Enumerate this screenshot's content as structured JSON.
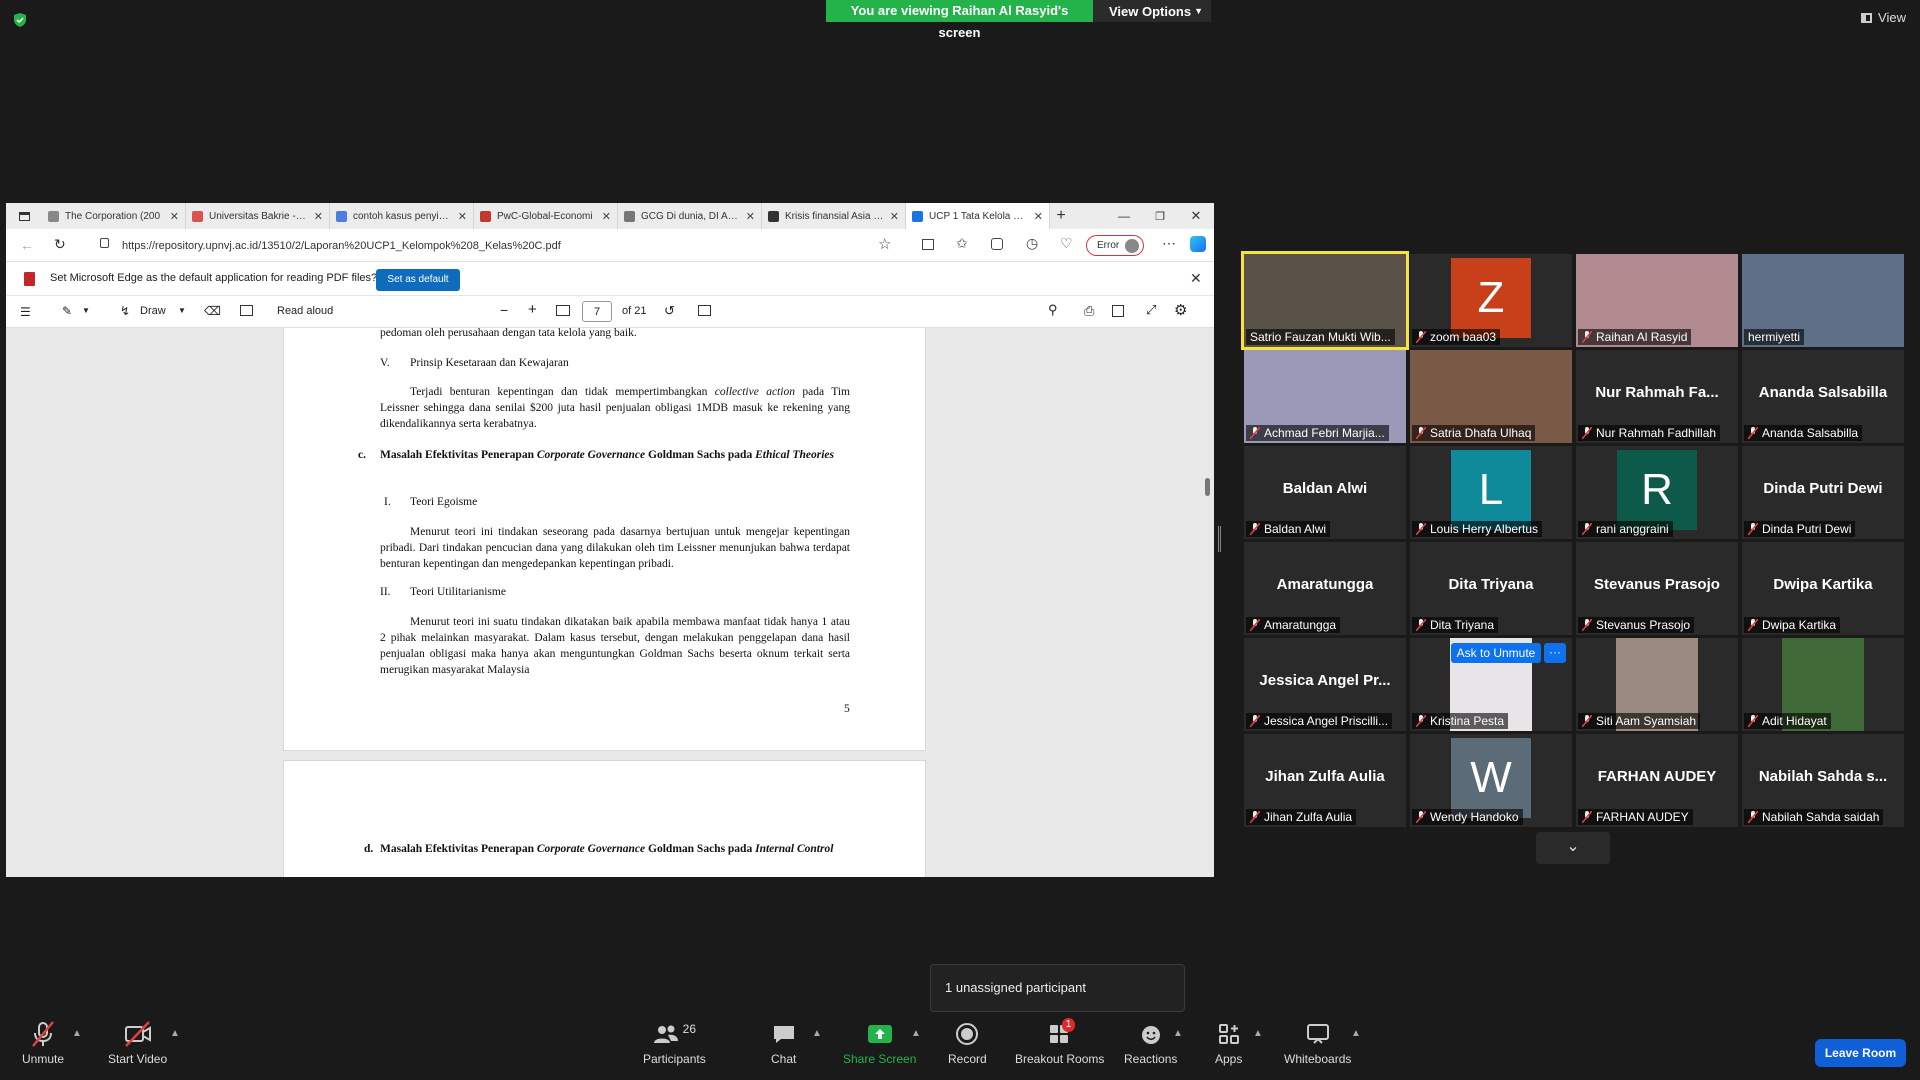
{
  "banner": {
    "message": "You are viewing Raihan Al Rasyid's screen",
    "view_options": "View Options",
    "view_label": "View"
  },
  "browser": {
    "tabs": [
      {
        "title": "The Corporation (200",
        "color": "#888888"
      },
      {
        "title": "Universitas Bakrie - SI",
        "color": "#d9534f"
      },
      {
        "title": "contoh kasus penyimp",
        "color": "#4a7fe0"
      },
      {
        "title": "PwC-Global-Economi",
        "color": "#c0392b"
      },
      {
        "title": "GCG Di dunia, DI Asia",
        "color": "#777777"
      },
      {
        "title": "Krisis finansial Asia 19",
        "color": "#333333"
      },
      {
        "title": "UCP 1 Tata Kelola dan",
        "color": "#1a73e8"
      }
    ],
    "url": "https://repository.upnvj.ac.id/13510/2/Laporan%20UCP1_Kelompok%208_Kelas%20C.pdf",
    "error_label": "Error",
    "infobar_text": "Set Microsoft Edge as the default application for reading PDF files?",
    "set_default": "Set as default",
    "draw": "Draw",
    "read_aloud": "Read aloud",
    "page_number": "7",
    "page_total": "of 21"
  },
  "document": {
    "line_top": "pedoman oleh perusahaan dengan tata kelola yang baik.",
    "v_num": "V.",
    "v_title": "Prinsip Kesetaraan dan Kewajaran",
    "para1_a": "Terjadi benturan kepentingan dan tidak mempertimbangkan ",
    "para1_em": "collective action",
    "para1_b": " pada Tim Leissner sehingga dana senilai $200 juta hasil penjualan obligasi  1MDB masuk ke rekening yang dikendalikannya serta kerabatnya.",
    "c_num": "c.",
    "c_title_a": "Masalah Efektivitas Penerapan ",
    "c_title_em": "Corporate Governance",
    "c_title_b": " Goldman Sachs pada ",
    "c_title_em2": "Ethical Theories",
    "i_num": "I.",
    "i_title": "Teori Egoisme",
    "para2": "Menurut teori ini tindakan seseorang pada dasarnya bertujuan untuk mengejar kepentingan pribadi. Dari tindakan pencucian dana yang dilakukan oleh tim Leissner menunjukan bahwa terdapat benturan kepentingan dan mengedepankan kepentingan pribadi.",
    "ii_num": "II.",
    "ii_title": "Teori Utilitarianisme",
    "para3": "Menurut teori ini suatu tindakan dikatakan baik apabila membawa manfaat tidak hanya 1 atau 2 pihak melainkan masyarakat. Dalam kasus tersebut, dengan melakukan penggelapan dana hasil penjualan obligasi maka hanya akan menguntungkan Goldman Sachs beserta oknum terkait serta merugikan masyarakat Malaysia",
    "page_num": "5",
    "d_num": "d.",
    "d_title_a": "Masalah Efektivitas Penerapan ",
    "d_title_em": "Corporate Governance",
    "d_title_b": " Goldman Sachs pada ",
    "d_title_em2": "Internal Control"
  },
  "gallery": [
    {
      "label": "Satrio Fauzan Mukti Wib...",
      "video": true,
      "bg": "#5a5248",
      "active": true,
      "muted": false
    },
    {
      "label": "zoom baa03",
      "initial": "Z",
      "color": "#c8401a",
      "muted": true
    },
    {
      "label": "Raihan Al Rasyid",
      "video": true,
      "bg": "#b08a8e",
      "muted": true
    },
    {
      "label": "hermiyetti",
      "video": true,
      "bg": "#5e7088",
      "muted": false
    },
    {
      "label": "Achmad Febri Marjia...",
      "video": true,
      "bg": "#9a9ab8",
      "muted": true
    },
    {
      "label": "Satria Dhafa Ulhaq",
      "video": true,
      "bg": "#7a5a46",
      "muted": true
    },
    {
      "label": "Nur Rahmah Fadhillah",
      "name": "Nur Rahmah Fa...",
      "muted": true
    },
    {
      "label": "Ananda Salsabilla",
      "name": "Ananda Salsabilla",
      "muted": true
    },
    {
      "label": "Baldan Alwi",
      "name": "Baldan Alwi",
      "muted": true
    },
    {
      "label": "Louis Herry Albertus",
      "initial": "L",
      "color": "#0e8a9b",
      "muted": true
    },
    {
      "label": "rani anggraini",
      "initial": "R",
      "color": "#0e5a4a",
      "muted": true
    },
    {
      "label": "Dinda Putri Dewi",
      "name": "Dinda Putri Dewi",
      "muted": true
    },
    {
      "label": "Amaratungga",
      "name": "Amaratungga",
      "muted": true
    },
    {
      "label": "Dita Triyana",
      "name": "Dita Triyana",
      "muted": true
    },
    {
      "label": "Stevanus Prasojo",
      "name": "Stevanus Prasojo",
      "muted": true
    },
    {
      "label": "Dwipa Kartika",
      "name": "Dwipa Kartika",
      "muted": true
    },
    {
      "label": "Jessica Angel Priscilli...",
      "name": "Jessica Angel Pr...",
      "muted": true
    },
    {
      "label": "Kristina Pesta",
      "video": true,
      "bg": "#e8e4e8",
      "muted": true
    },
    {
      "label": "Siti Aam Syamsiah",
      "video": true,
      "bg": "#9a8a80",
      "muted": true
    },
    {
      "label": "Adit Hidayat",
      "video": true,
      "bg": "#3f6a38",
      "muted": true
    },
    {
      "label": "Jihan Zulfa Aulia",
      "name": "Jihan Zulfa Aulia",
      "muted": true
    },
    {
      "label": "Wendy Handoko",
      "initial": "W",
      "color": "#5c6b78",
      "muted": true
    },
    {
      "label": "FARHAN AUDEY",
      "name": "FARHAN AUDEY",
      "muted": true
    },
    {
      "label": "Nabilah Sahda saidah",
      "name": "Nabilah Sahda s...",
      "muted": true
    }
  ],
  "ask_to_unmute": "Ask to Unmute",
  "more_label": "···",
  "unassigned": "1 unassigned participant",
  "toolbar": {
    "unmute": "Unmute",
    "start_video": "Start Video",
    "participants": "Participants",
    "participants_count": "26",
    "chat": "Chat",
    "share_screen": "Share Screen",
    "record": "Record",
    "breakout_rooms": "Breakout Rooms",
    "breakout_badge": "1",
    "reactions": "Reactions",
    "apps": "Apps",
    "whiteboards": "Whiteboards",
    "leave_room": "Leave Room"
  },
  "colors": {
    "banner_green": "#24b34b",
    "leave_blue": "#0e5fd8",
    "edge_blue": "#0f6cbd",
    "active_tile": "#f5e23c",
    "muted_red": "#e04040"
  }
}
